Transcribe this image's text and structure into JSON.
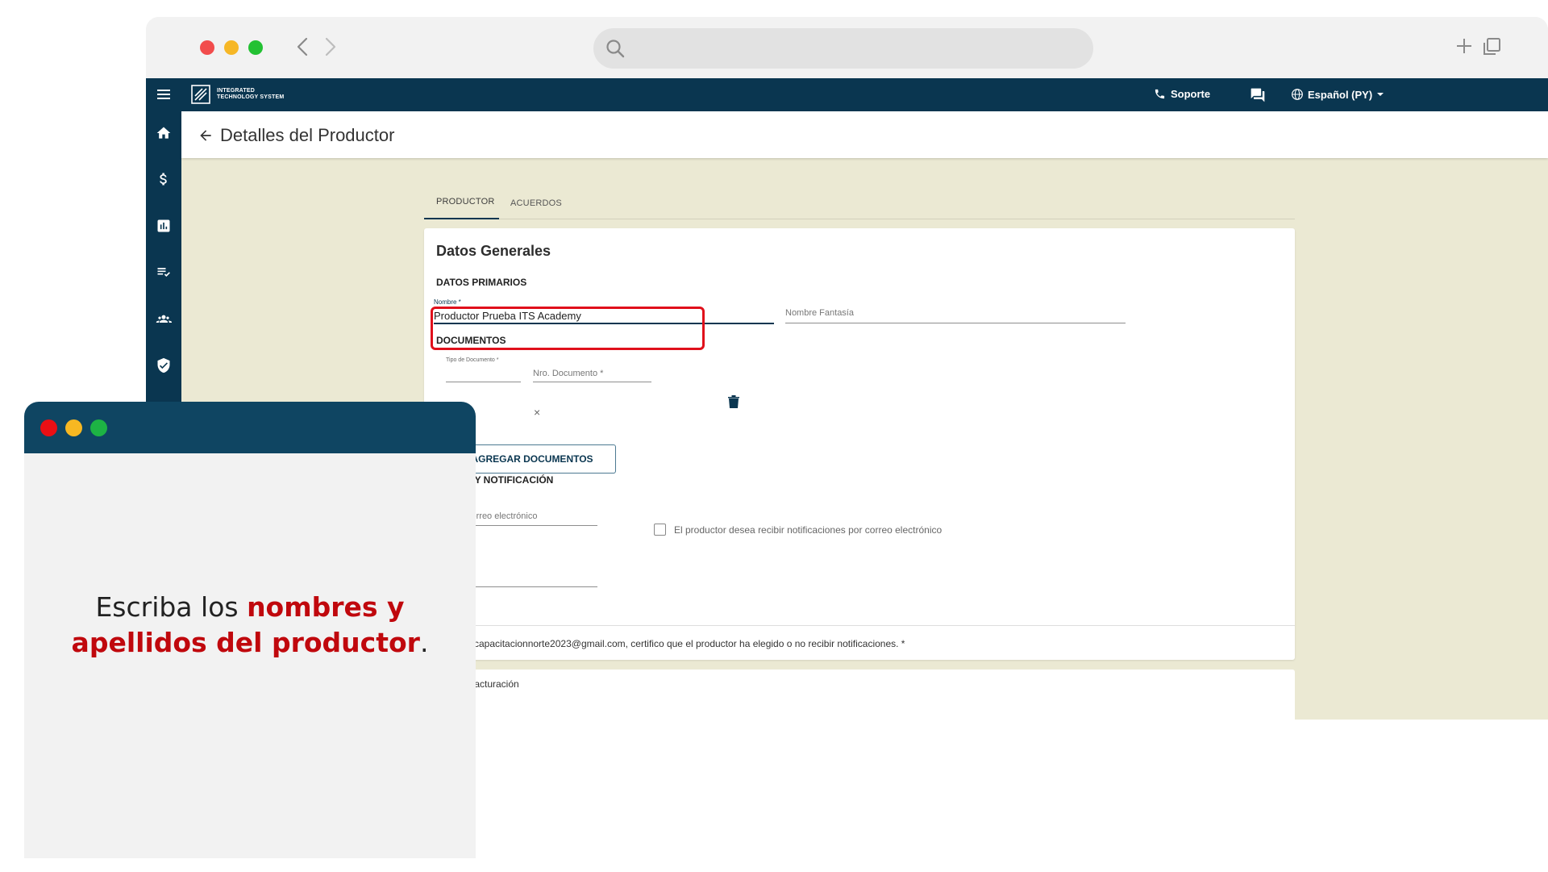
{
  "app": {
    "logo_text_line1": "INTEGRATED",
    "logo_text_line2": "TECHNOLOGY SYSTEM",
    "support_label": "Soporte",
    "language_label": "Español (PY)"
  },
  "sidebar": {
    "items": [
      {
        "icon": "home-icon"
      },
      {
        "icon": "dollar-icon"
      },
      {
        "icon": "chart-icon"
      },
      {
        "icon": "checklist-icon"
      },
      {
        "icon": "group-icon"
      },
      {
        "icon": "shield-check-icon"
      }
    ]
  },
  "page": {
    "title": "Detalles del Productor"
  },
  "tabs": [
    {
      "label": "PRODUCTOR",
      "active": true
    },
    {
      "label": "ACUERDOS",
      "active": false
    }
  ],
  "form": {
    "card_title": "Datos Generales",
    "section_primary": "DATOS PRIMARIOS",
    "name_label": "Nombre *",
    "name_value": "Productor Prueba ITS Academy",
    "fantasy_placeholder": "Nombre Fantasía",
    "section_documents": "DOCUMENTOS",
    "doc_type_label": "Tipo de Documento *",
    "doc_clear": "×",
    "doc_number_placeholder": "Nro. Documento *",
    "add_documents_button": "AGREGAR DOCUMENTOS",
    "section_contact": "TO Y NOTIFICACIÓN",
    "email_placeholder": "correo electrónico",
    "notify_checkbox_label": "El productor desea recibir notificaciones por correo electrónico",
    "notify_checked": false,
    "certify_text": "capacitacionnorte2023@gmail.com, certifico que el productor ha elegido o no recibir notificaciones. *",
    "billing_section": "Facturación"
  },
  "overlay": {
    "text_prefix": "Escriba los ",
    "text_highlight_1": "nombres y",
    "text_highlight_2": "apellidos del productor",
    "text_suffix": ".",
    "highlight_color": "#c0080d"
  },
  "colors": {
    "primary": "#0a3650",
    "background": "#ebe9d3",
    "highlight_border": "#e0101b"
  }
}
